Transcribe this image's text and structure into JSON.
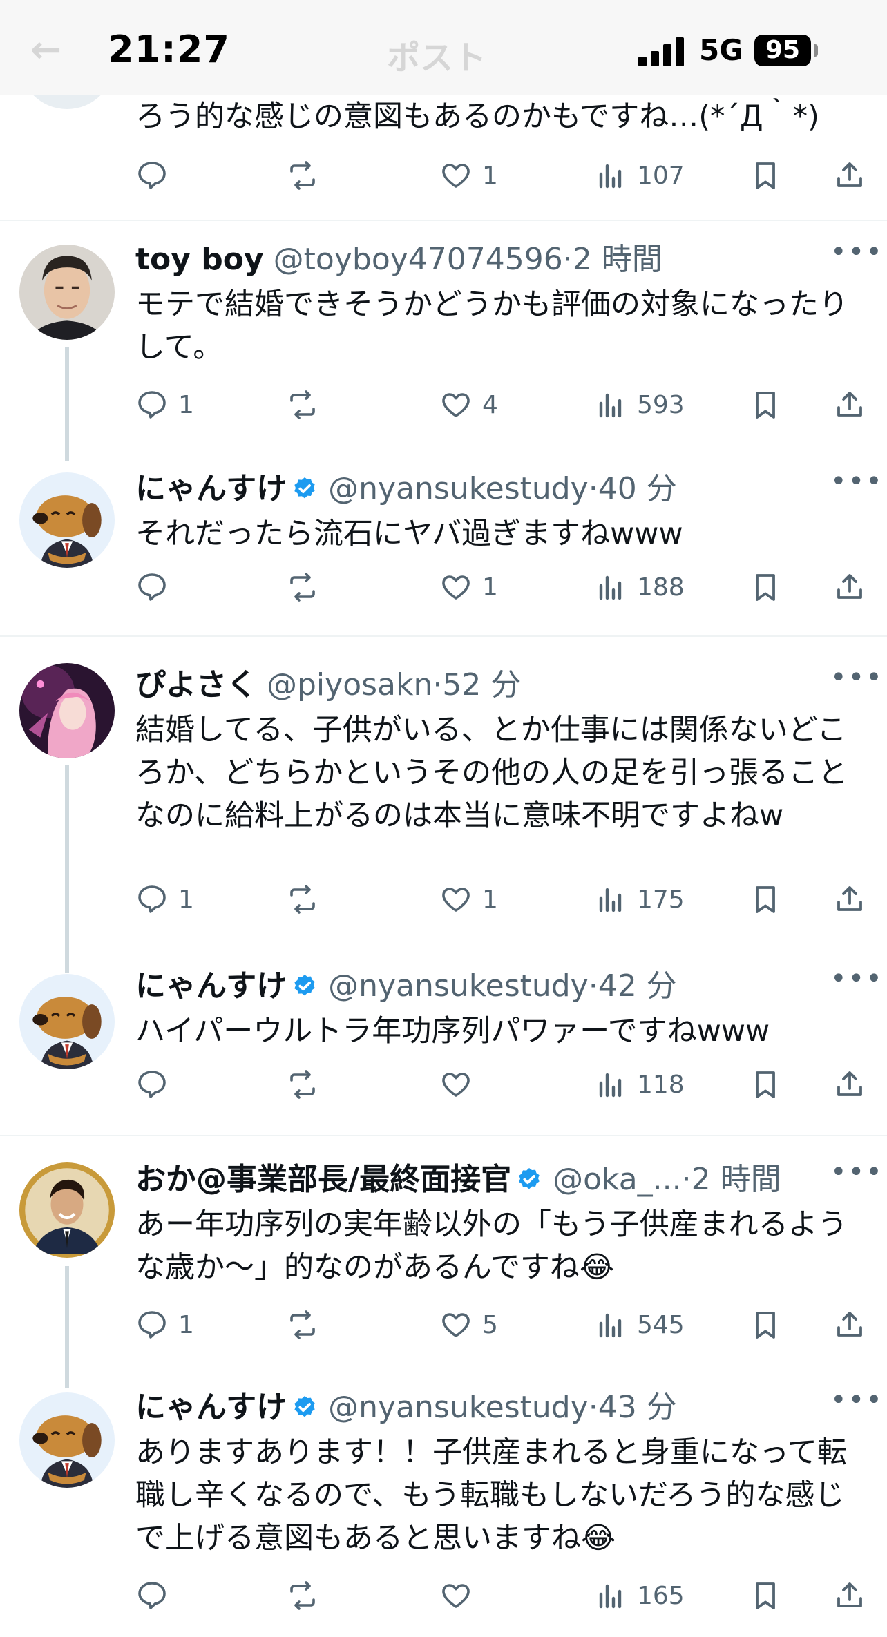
{
  "status_bar": {
    "time": "21:27",
    "network": "5G",
    "battery": "95",
    "header_title": "ポスト",
    "back_icon": "←"
  },
  "tweets": [
    {
      "name": "",
      "handle": "",
      "time": "",
      "text": "ろう的な感じの意図もあるのかもですね…(*´Д｀*)",
      "replies": "",
      "likes": "1",
      "views": "107",
      "verified": false
    },
    {
      "name": "toy boy",
      "handle": "@toyboy47074596",
      "time": "2 時間",
      "text": "モテで結婚できそうかどうかも評価の対象になったりして。",
      "replies": "1",
      "likes": "4",
      "views": "593",
      "verified": false
    },
    {
      "name": "にゃんすけ",
      "handle": "@nyansukestudy",
      "time": "40 分",
      "text": "それだったら流石にヤバ過ぎますねwww",
      "replies": "",
      "likes": "1",
      "views": "188",
      "verified": true
    },
    {
      "name": "ぴよさく",
      "handle": "@piyosakn",
      "time": "52 分",
      "text": "結婚してる、子供がいる、とか仕事には関係ないどころか、どちらかというその他の人の足を引っ張ることなのに給料上がるのは本当に意味不明ですよねw",
      "replies": "1",
      "likes": "1",
      "views": "175",
      "verified": false
    },
    {
      "name": "にゃんすけ",
      "handle": "@nyansukestudy",
      "time": "42 分",
      "text": "ハイパーウルトラ年功序列パワァーですねwww",
      "replies": "",
      "likes": "",
      "views": "118",
      "verified": true
    },
    {
      "name": "おか@事業部長/最終面接官",
      "handle": "@oka_...",
      "time": "2 時間",
      "text": "あー年功序列の実年齢以外の「もう子供産まれるような歳か〜」的なのがあるんですね😂",
      "replies": "1",
      "likes": "5",
      "views": "545",
      "verified": true
    },
    {
      "name": "にゃんすけ",
      "handle": "@nyansukestudy",
      "time": "43 分",
      "text": "ありますあります！！子供産まれると身重になって転職し辛くなるので、もう転職もしないだろう的な感じで上げる意図もあると思いますね😂",
      "replies": "",
      "likes": "",
      "views": "165",
      "verified": true
    }
  ],
  "icons": {
    "reply": "reply-icon",
    "repost": "repost-icon",
    "like": "heart-icon",
    "views": "views-icon",
    "bookmark": "bookmark-icon",
    "share": "share-icon",
    "more": "more-icon",
    "verified": "verified-badge-icon"
  },
  "colors": {
    "verified": "#1d9bf0",
    "secondary_text": "#536471",
    "thread_line": "#cfd9de"
  }
}
